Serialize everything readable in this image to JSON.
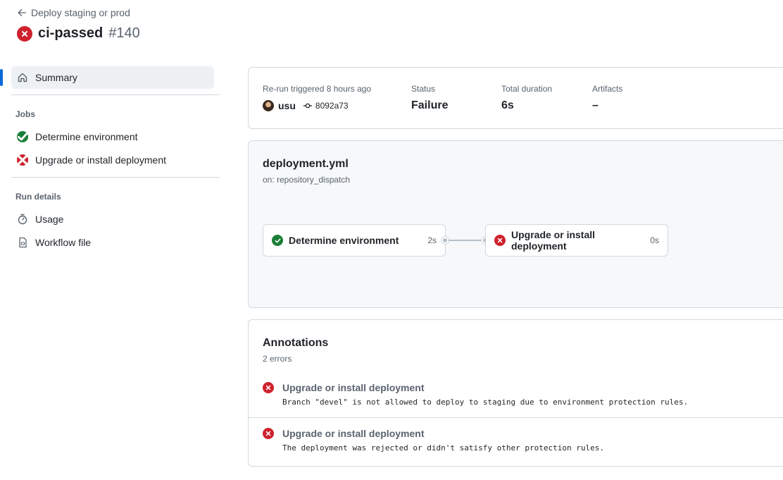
{
  "header": {
    "back_label": "Deploy staging or prod",
    "run_name": "ci-passed",
    "run_number": "#140"
  },
  "sidebar": {
    "summary_label": "Summary",
    "jobs_heading": "Jobs",
    "jobs": [
      {
        "label": "Determine environment",
        "status": "success"
      },
      {
        "label": "Upgrade or install deployment",
        "status": "failure"
      }
    ],
    "run_details_heading": "Run details",
    "run_details": [
      {
        "label": "Usage",
        "icon": "stopwatch-icon"
      },
      {
        "label": "Workflow file",
        "icon": "workflow-file-icon"
      }
    ]
  },
  "summary": {
    "trigger_label": "Re-run triggered 8 hours ago",
    "actor": "usu",
    "commit": "8092a73",
    "status_label": "Status",
    "status_value": "Failure",
    "duration_label": "Total duration",
    "duration_value": "6s",
    "artifacts_label": "Artifacts",
    "artifacts_value": "–"
  },
  "workflow": {
    "file": "deployment.yml",
    "trigger": "on: repository_dispatch",
    "jobs": [
      {
        "name": "Determine environment",
        "duration": "2s",
        "status": "success"
      },
      {
        "name": "Upgrade or install deployment",
        "duration": "0s",
        "status": "failure"
      }
    ]
  },
  "annotations": {
    "title": "Annotations",
    "count": "2 errors",
    "items": [
      {
        "job": "Upgrade or install deployment",
        "message": "Branch \"devel\" is not allowed to deploy to staging due to environment protection rules."
      },
      {
        "job": "Upgrade or install deployment",
        "message": "The deployment was rejected or didn't satisfy other protection rules."
      }
    ]
  },
  "colors": {
    "failure": "#cf222e",
    "success": "#1a7f37",
    "accent": "#0969da"
  }
}
